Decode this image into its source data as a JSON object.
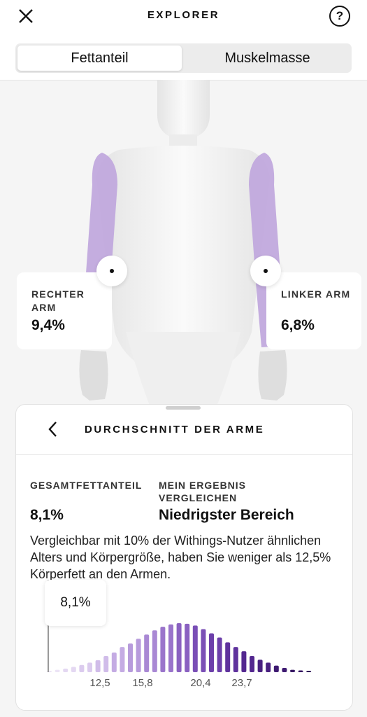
{
  "header": {
    "title": "EXPLORER",
    "help_symbol": "?",
    "tabs": [
      {
        "label": "Fettanteil",
        "selected": true
      },
      {
        "label": "Muskelmasse",
        "selected": false
      }
    ]
  },
  "body_view": {
    "highlight_color": "#bfa5dd",
    "right_arm": {
      "label": "RECHTER ARM",
      "value": "9,4%"
    },
    "left_arm": {
      "label": "LINKER ARM",
      "value": "6,8%"
    }
  },
  "sheet": {
    "title": "DURCHSCHNITT DER ARME",
    "total_label": "GESAMTFETTANTEIL",
    "total_value": "8,1%",
    "compare_label": "MEIN ERGEBNIS VERGLEICHEN",
    "compare_value": "Niedrigster Bereich",
    "description": "Vergleichbar mit 10% der Withings-Nutzer ähnlichen Alters und Körpergröße, haben Sie weniger als 12,5% Körperfett an den Armen."
  },
  "chart_data": {
    "type": "bar",
    "marker_label": "8,1%",
    "marker_value": 8.1,
    "tick_labels": [
      "12,5",
      "15,8",
      "20,4",
      "23,7"
    ],
    "values": [
      0.02,
      0.04,
      0.06,
      0.09,
      0.12,
      0.16,
      0.2,
      0.27,
      0.33,
      0.42,
      0.48,
      0.56,
      0.63,
      0.7,
      0.76,
      0.8,
      0.82,
      0.81,
      0.78,
      0.72,
      0.65,
      0.58,
      0.5,
      0.42,
      0.35,
      0.27,
      0.21,
      0.16,
      0.11,
      0.07,
      0.04,
      0.03,
      0.02
    ],
    "colors": [
      "#ece4f6",
      "#e4d8f2",
      "#dbcbee",
      "#d0bce9",
      "#c4abe3",
      "#b79bdc",
      "#a988d4",
      "#9a74cb",
      "#8a61c1",
      "#7a4fb6",
      "#6c3faa",
      "#5f329d",
      "#53278f",
      "#481f80",
      "#3e1a71",
      "#351562",
      "#2c1155"
    ]
  }
}
